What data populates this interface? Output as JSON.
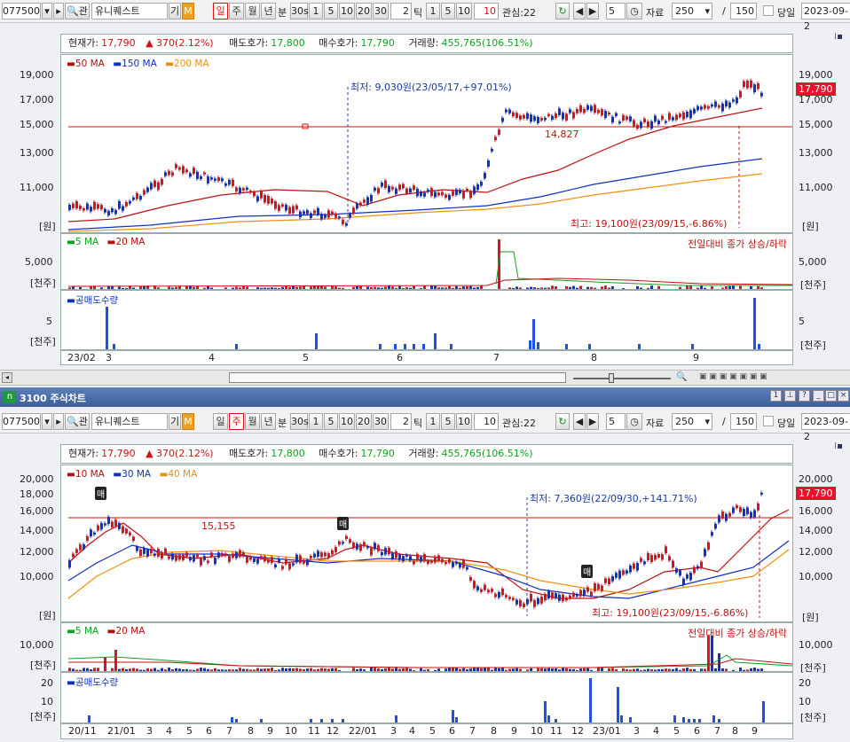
{
  "toolbar": {
    "code": "077500",
    "name": "유니퀘스트",
    "gi": "기",
    "m": "M",
    "periods": [
      "일",
      "주",
      "월",
      "년"
    ],
    "bun": "분",
    "minute_opts": [
      "30s",
      "1",
      "5",
      "10",
      "20",
      "30"
    ],
    "tick_value": "2",
    "tick_label": "틱",
    "tick_opts": [
      "1",
      "5",
      "10"
    ],
    "tick_active": "10",
    "gwansim": "관심:22",
    "step": "5",
    "jaryo_label": "자료",
    "jaryo_value": "250",
    "slash": "/",
    "count": "150",
    "dangil": "당일",
    "date": "2023-09-2"
  },
  "chart_top": {
    "info": {
      "cur_label": "현재가:",
      "cur_value": "17,790",
      "change": "▲ 370(2.12%)",
      "sell_label": "매도호가:",
      "sell_value": "17,800",
      "buy_label": "매수호가:",
      "buy_value": "17,790",
      "vol_label": "거래량:",
      "vol_value": "455,765(106.51%)"
    },
    "ma_legend": [
      "50 MA",
      "150 MA",
      "200 MA"
    ],
    "y_ticks": [
      "19,000",
      "17,000",
      "15,000",
      "13,000",
      "11,000"
    ],
    "unit": "[원]",
    "low_note": "최저: 9,030원(23/05/17,+97.01%)",
    "high_note": "최고: 19,100원(23/09/15,-6.86%)",
    "mid_value": "14,827",
    "price_tag": "17,790",
    "vol_legend": [
      "5 MA",
      "20 MA"
    ],
    "vol_note": "전일대비 종가 상승/하락",
    "vol_tick": "5,000",
    "vol_unit": "[천주]",
    "short_legend": "공매도수량",
    "short_tick": "5",
    "short_unit": "[천주]",
    "x_labels": [
      "23/02",
      "3",
      "4",
      "5",
      "6",
      "7",
      "8",
      "9"
    ]
  },
  "window_title": "3100 주식차트",
  "chart_bottom": {
    "info": {
      "cur_label": "현재가:",
      "cur_value": "17,790",
      "change": "▲ 370(2.12%)",
      "sell_label": "매도호가:",
      "sell_value": "17,800",
      "buy_label": "매수호가:",
      "buy_value": "17,790",
      "vol_label": "거래량:",
      "vol_value": "455,765(106.51%)"
    },
    "ma_legend": [
      "10 MA",
      "30 MA",
      "40 MA"
    ],
    "y_ticks": [
      "20,000",
      "18,000",
      "16,000",
      "14,000",
      "12,000",
      "10,000"
    ],
    "unit": "[원]",
    "level": "15,155",
    "low_note": "최저: 7,360원(22/09/30,+141.71%)",
    "high_note": "최고: 19,100원(23/09/15,-6.86%)",
    "price_tag": "17,790",
    "sell_marker": "매",
    "vol_legend": [
      "5 MA",
      "20 MA"
    ],
    "vol_note": "전일대비 종가 상승/하락",
    "vol_tick": "10,000",
    "vol_unit": "[천주]",
    "short_legend": "공매도수량",
    "short_ticks": [
      "20",
      "10"
    ],
    "short_unit": "[천주]",
    "x_labels": [
      "20/11",
      "21/01",
      "3",
      "4",
      "5",
      "6",
      "7",
      "8",
      "9",
      "10",
      "11",
      "12",
      "22/01",
      "3",
      "4",
      "5",
      "6",
      "7",
      "8",
      "9",
      "10",
      "11",
      "12",
      "23/01",
      "3",
      "4",
      "5",
      "6",
      "7",
      "8",
      "9"
    ]
  }
}
